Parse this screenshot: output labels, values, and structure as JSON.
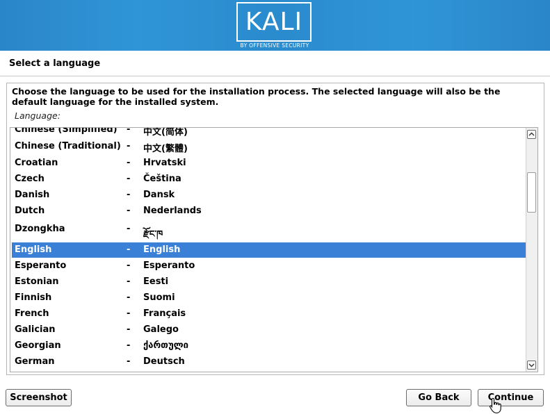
{
  "brand": {
    "logo_text": "KALI",
    "logo_subtitle": "BY OFFENSIVE SECURITY"
  },
  "page": {
    "title": "Select a language"
  },
  "prompt": {
    "description": "Choose the language to be used for the installation process. The selected language will also be the default language for the installed system.",
    "field_label": "Language:"
  },
  "languages": [
    {
      "name": "Chinese (Simplified)",
      "sep": "-",
      "native": "中文(简体)"
    },
    {
      "name": "Chinese (Traditional)",
      "sep": "-",
      "native": "中文(繁體)"
    },
    {
      "name": "Croatian",
      "sep": "-",
      "native": "Hrvatski"
    },
    {
      "name": "Czech",
      "sep": "-",
      "native": "Čeština"
    },
    {
      "name": "Danish",
      "sep": "-",
      "native": "Dansk"
    },
    {
      "name": "Dutch",
      "sep": "-",
      "native": "Nederlands"
    },
    {
      "name": "Dzongkha",
      "sep": "-",
      "native": "རྫོང་ཁ"
    },
    {
      "name": "English",
      "sep": "-",
      "native": "English"
    },
    {
      "name": "Esperanto",
      "sep": "-",
      "native": "Esperanto"
    },
    {
      "name": "Estonian",
      "sep": "-",
      "native": "Eesti"
    },
    {
      "name": "Finnish",
      "sep": "-",
      "native": "Suomi"
    },
    {
      "name": "French",
      "sep": "-",
      "native": "Français"
    },
    {
      "name": "Galician",
      "sep": "-",
      "native": "Galego"
    },
    {
      "name": "Georgian",
      "sep": "-",
      "native": "ქართული"
    },
    {
      "name": "German",
      "sep": "-",
      "native": "Deutsch"
    }
  ],
  "selected_language": "English",
  "buttons": {
    "screenshot": "Screenshot",
    "go_back": "Go Back",
    "continue": "Continue"
  },
  "colors": {
    "banner": "#2f95d6",
    "selection": "#3a80d6"
  }
}
